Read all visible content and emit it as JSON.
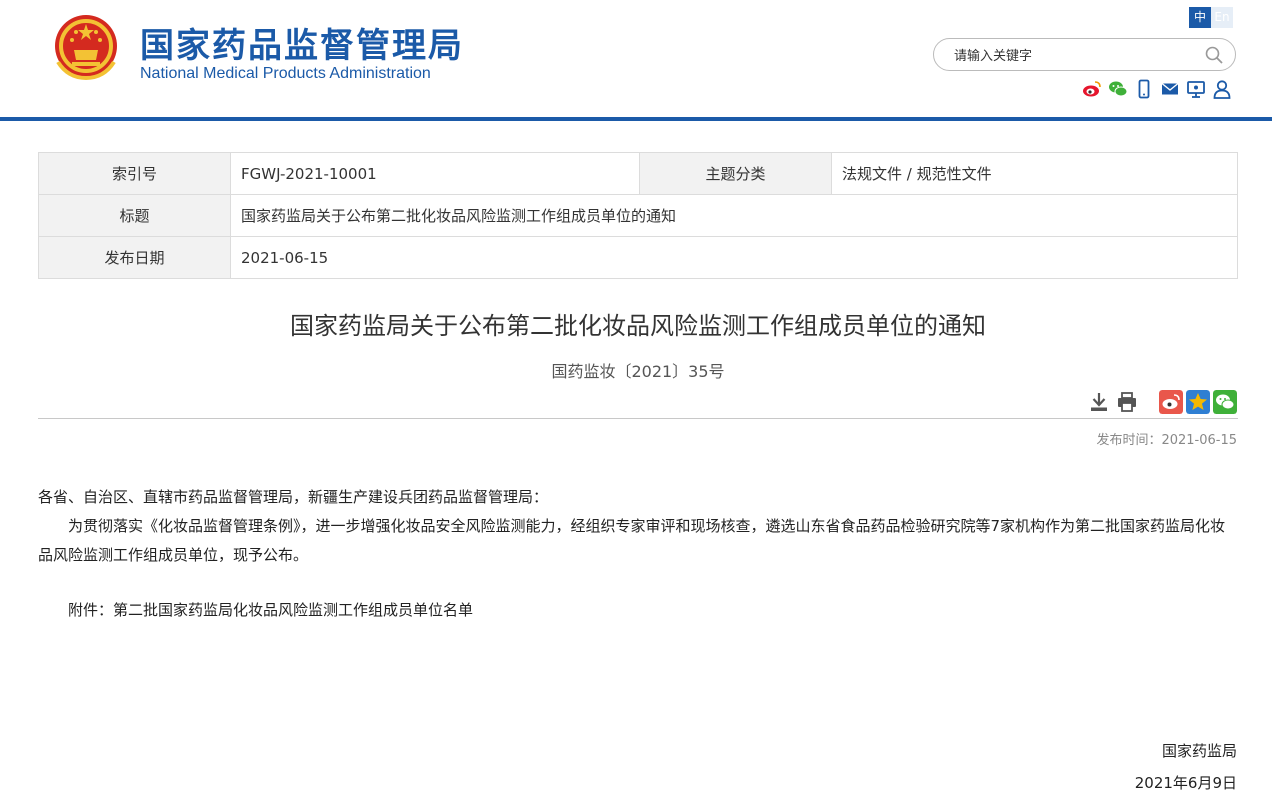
{
  "header": {
    "title": "国家药品监督管理局",
    "subtitle": "National Medical Products Administration",
    "lang_zh": "中",
    "lang_en": "En",
    "search_placeholder": "请输入关键字"
  },
  "meta": {
    "index_label": "索引号",
    "index_value": "FGWJ-2021-10001",
    "category_label": "主题分类",
    "category_value": "法规文件 / 规范性文件",
    "title_label": "标题",
    "title_value": "国家药监局关于公布第二批化妆品风险监测工作组成员单位的通知",
    "date_label": "发布日期",
    "date_value": "2021-06-15"
  },
  "article": {
    "title": "国家药监局关于公布第二批化妆品风险监测工作组成员单位的通知",
    "doc_number": "国药监妆〔2021〕35号",
    "publish_time": "发布时间：2021-06-15",
    "salutation": "各省、自治区、直辖市药品监督管理局，新疆生产建设兵团药品监督管理局：",
    "paragraph1": "为贯彻落实《化妆品监督管理条例》，进一步增强化妆品安全风险监测能力，经组织专家审评和现场核查，遴选山东省食品药品检验研究院等7家机构作为第二批国家药监局化妆品风险监测工作组成员单位，现予公布。",
    "attachment": "附件：第二批国家药监局化妆品风险监测工作组成员单位名单",
    "signature": "国家药监局",
    "sign_date": "2021年6月9日"
  },
  "colors": {
    "brand_blue": "#1b5aa8",
    "weibo": "#e6162d",
    "wechat": "#3fb039",
    "qzone": "#f5b800"
  },
  "icons": {
    "top_share": [
      "weibo-icon",
      "wechat-icon",
      "mobile-icon",
      "mail-icon",
      "screen-icon",
      "user-icon"
    ],
    "tools": [
      "download-icon",
      "print-icon",
      "weibo-share-icon",
      "qzone-share-icon",
      "wechat-share-icon"
    ]
  }
}
